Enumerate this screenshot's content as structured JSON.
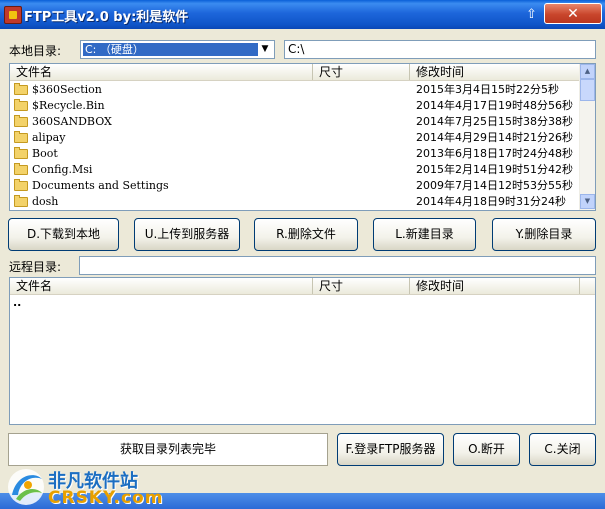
{
  "window": {
    "title": "FTP工具v2.0  by:利是软件",
    "pin_glyph": "⇧",
    "close_glyph": "✕"
  },
  "local": {
    "label": "本地目录:",
    "drive_selected": "C: （硬盘）",
    "path_value": "C:\\",
    "columns": {
      "name": "文件名",
      "size": "尺寸",
      "mtime": "修改时间"
    },
    "files": [
      {
        "name": "$360Section",
        "mtime": "2015年3月4日15时22分5秒"
      },
      {
        "name": "$Recycle.Bin",
        "mtime": "2014年4月17日19时48分56秒"
      },
      {
        "name": "360SANDBOX",
        "mtime": "2014年7月25日15时38分38秒"
      },
      {
        "name": "alipay",
        "mtime": "2014年4月29日14时21分26秒"
      },
      {
        "name": "Boot",
        "mtime": "2013年6月18日17时24分48秒"
      },
      {
        "name": "Config.Msi",
        "mtime": "2015年2月14日19时51分42秒"
      },
      {
        "name": "Documents and Settings",
        "mtime": "2009年7月14日12时53分55秒"
      },
      {
        "name": "dosh",
        "mtime": "2014年4月18日9时31分24秒"
      }
    ]
  },
  "actions": {
    "download": "D.下载到本地",
    "upload": "U.上传到服务器",
    "delete_file": "R.删除文件",
    "new_dir": "L.新建目录",
    "delete_dir": "Y.删除目录"
  },
  "remote": {
    "label": "远程目录:",
    "path_value": "",
    "columns": {
      "name": "文件名",
      "size": "尺寸",
      "mtime": "修改时间"
    },
    "files": [
      {
        "name": "..",
        "icon": "up-folder-icon"
      }
    ]
  },
  "status": {
    "text": "获取目录列表完毕"
  },
  "bottom_buttons": {
    "login": "F.登录FTP服务器",
    "disconnect": "O.断开",
    "close": "C.关闭"
  },
  "watermark": {
    "cn": "非凡软件站",
    "en": "CRSKY.com"
  }
}
